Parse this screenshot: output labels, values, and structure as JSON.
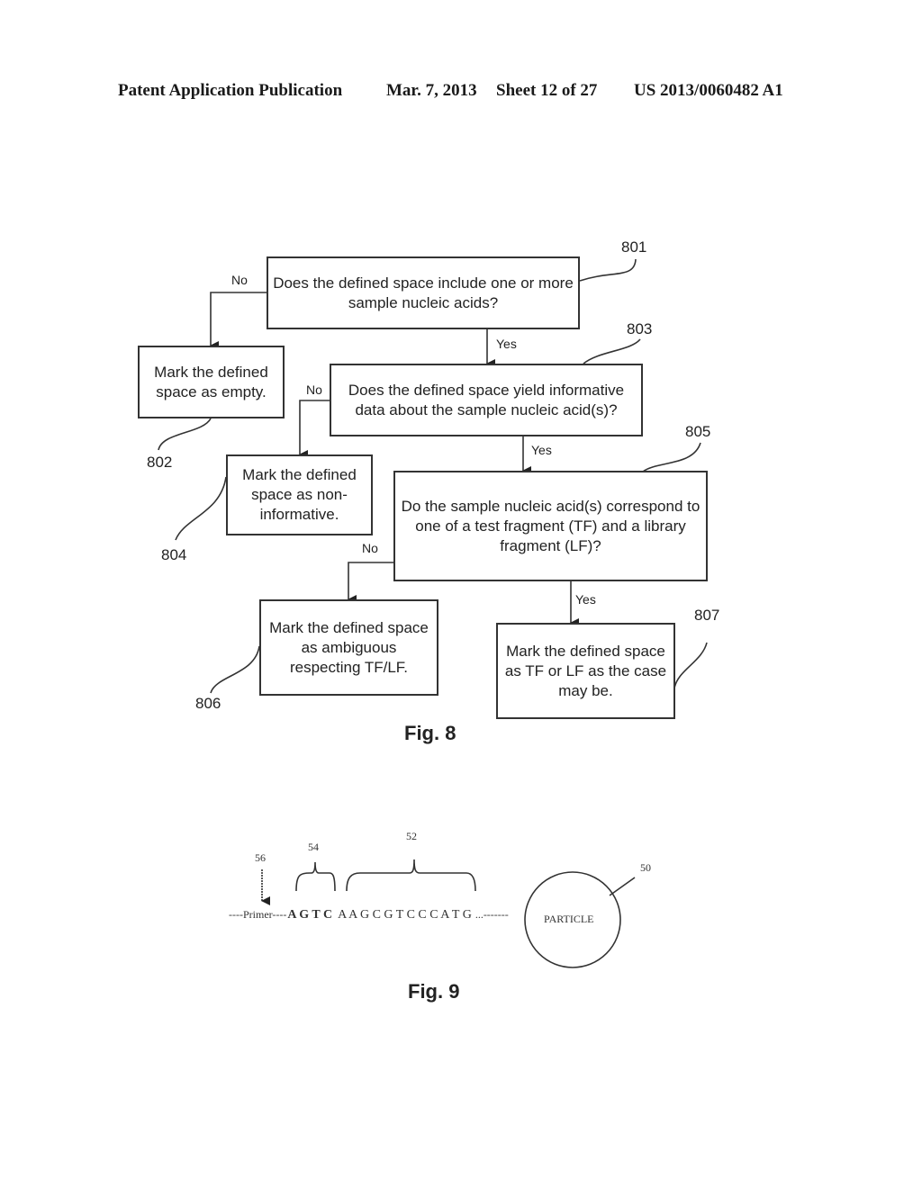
{
  "header": {
    "publication": "Patent Application Publication",
    "date": "Mar. 7, 2013",
    "sheet": "Sheet 12 of 27",
    "number": "US 2013/0060482 A1"
  },
  "fig8": {
    "caption": "Fig. 8",
    "nodes": {
      "n801": {
        "ref": "801",
        "text": "Does the defined space include one or more sample nucleic acids?"
      },
      "n802": {
        "ref": "802",
        "text": "Mark the defined space as empty."
      },
      "n803": {
        "ref": "803",
        "text": "Does the defined space yield informative data about the sample nucleic acid(s)?"
      },
      "n804": {
        "ref": "804",
        "text": "Mark the defined space as non-informative."
      },
      "n805": {
        "ref": "805",
        "text": "Do the sample nucleic acid(s) correspond to one of a test fragment (TF) and a library fragment (LF)?"
      },
      "n806": {
        "ref": "806",
        "text": "Mark the defined space as ambiguous respecting TF/LF."
      },
      "n807": {
        "ref": "807",
        "text": "Mark the defined space as TF or LF as the case may be."
      }
    },
    "edges": {
      "e801_802": "No",
      "e801_803": "Yes",
      "e803_804": "No",
      "e803_805": "Yes",
      "e805_806": "No",
      "e805_807": "Yes"
    }
  },
  "fig9": {
    "caption": "Fig. 9",
    "primer": "----Primer----",
    "key_seq": "A G T C",
    "seq": "A A G C G T C C C A T G",
    "trail": "...-------",
    "particle": "PARTICLE",
    "refs": {
      "primer_ref": "56",
      "key_ref": "54",
      "seq_ref": "52",
      "particle_ref": "50"
    }
  }
}
